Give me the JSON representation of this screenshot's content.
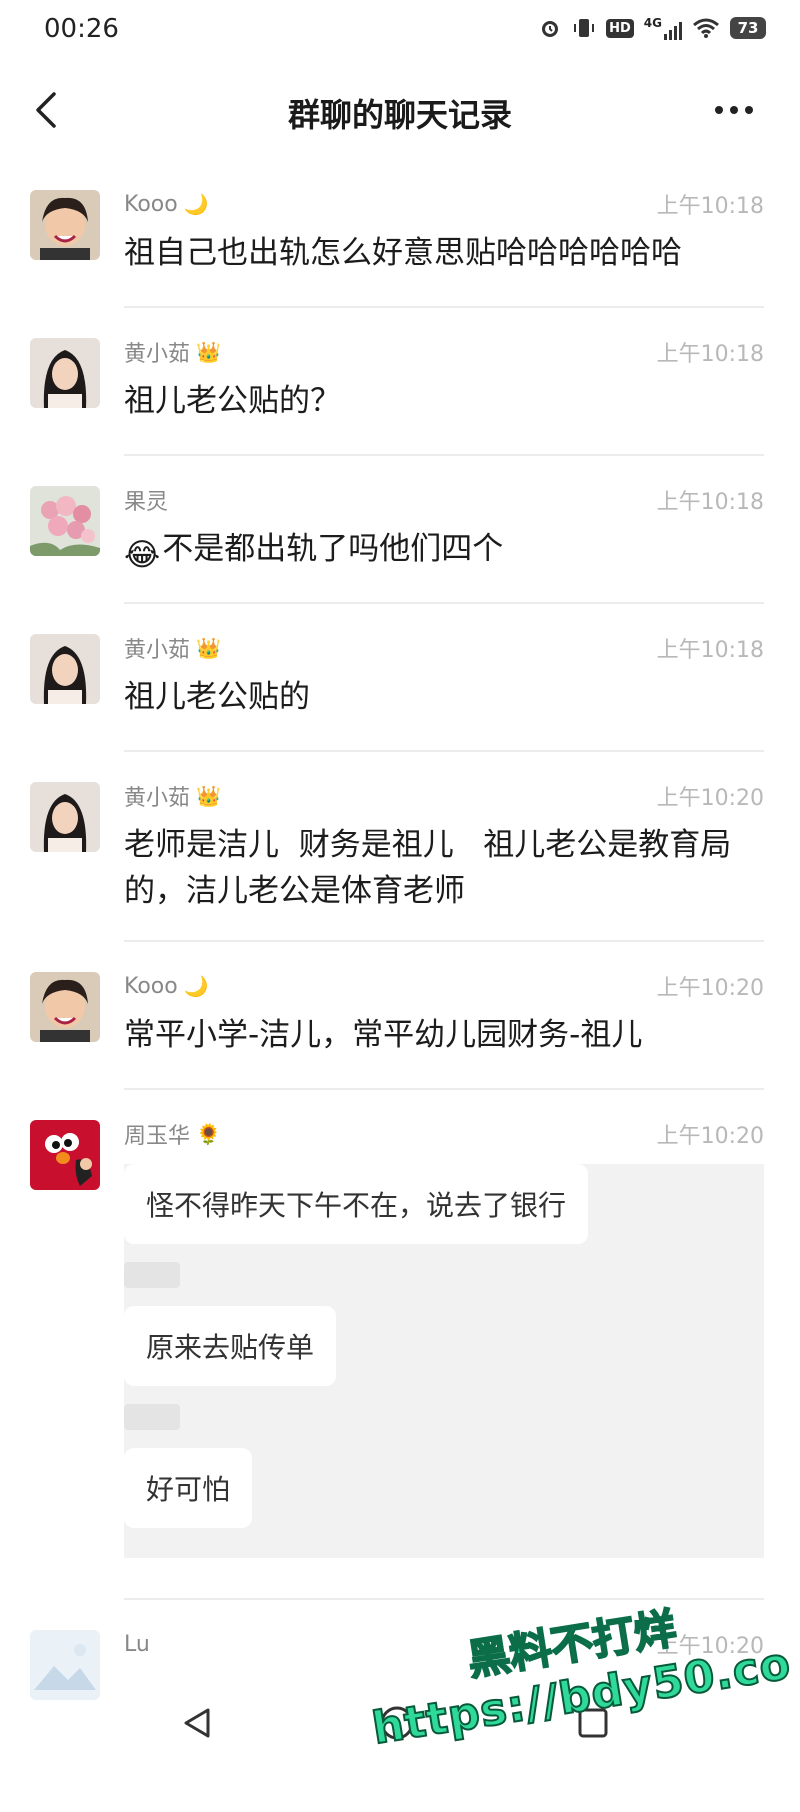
{
  "status_bar": {
    "time": "00:26",
    "battery": "73",
    "network": "4G",
    "hd_label": "HD"
  },
  "header": {
    "title": "群聊的聊天记录"
  },
  "messages": [
    {
      "sender": "Kooo",
      "badge": "🌙",
      "time": "上午10:18",
      "text": "祖自己也出轨怎么好意思贴哈哈哈哈哈哈",
      "avatar": "avatar-kooo"
    },
    {
      "sender": "黄小茹",
      "badge": "👑",
      "time": "上午10:18",
      "text": "祖儿老公贴的？",
      "avatar": "avatar-huang"
    },
    {
      "sender": "果灵",
      "badge": "",
      "time": "上午10:18",
      "emoji": "😂",
      "text": "不是都出轨了吗他们四个",
      "avatar": "avatar-flowers"
    },
    {
      "sender": "黄小茹",
      "badge": "👑",
      "time": "上午10:18",
      "text": "祖儿老公贴的",
      "avatar": "avatar-huang"
    },
    {
      "sender": "黄小茹",
      "badge": "👑",
      "time": "上午10:20",
      "text": "老师是洁儿  财务是祖儿   祖儿老公是教育局的，洁儿老公是体育老师",
      "avatar": "avatar-huang"
    },
    {
      "sender": "Kooo",
      "badge": "🌙",
      "time": "上午10:20",
      "text": "常平小学-洁儿，常平幼儿园财务-祖儿",
      "avatar": "avatar-kooo"
    },
    {
      "sender": "周玉华",
      "badge": "🌻",
      "time": "上午10:20",
      "bubbles": [
        "怪不得昨天下午不在，说去了银行",
        "原来去贴传单",
        "好可怕"
      ],
      "avatar": "avatar-elmo"
    },
    {
      "sender": "Lu",
      "badge": "",
      "time": "上午10:20",
      "text": "",
      "avatar": "avatar-placeholder"
    }
  ],
  "watermark": {
    "line1": "黑料不打烊",
    "line2": "https://bdy50.co"
  },
  "colors": {
    "background": "#ffffff",
    "divider": "#ececec",
    "sender": "#888888",
    "time": "#b8b8b8",
    "watermark": "#2fd99a"
  }
}
